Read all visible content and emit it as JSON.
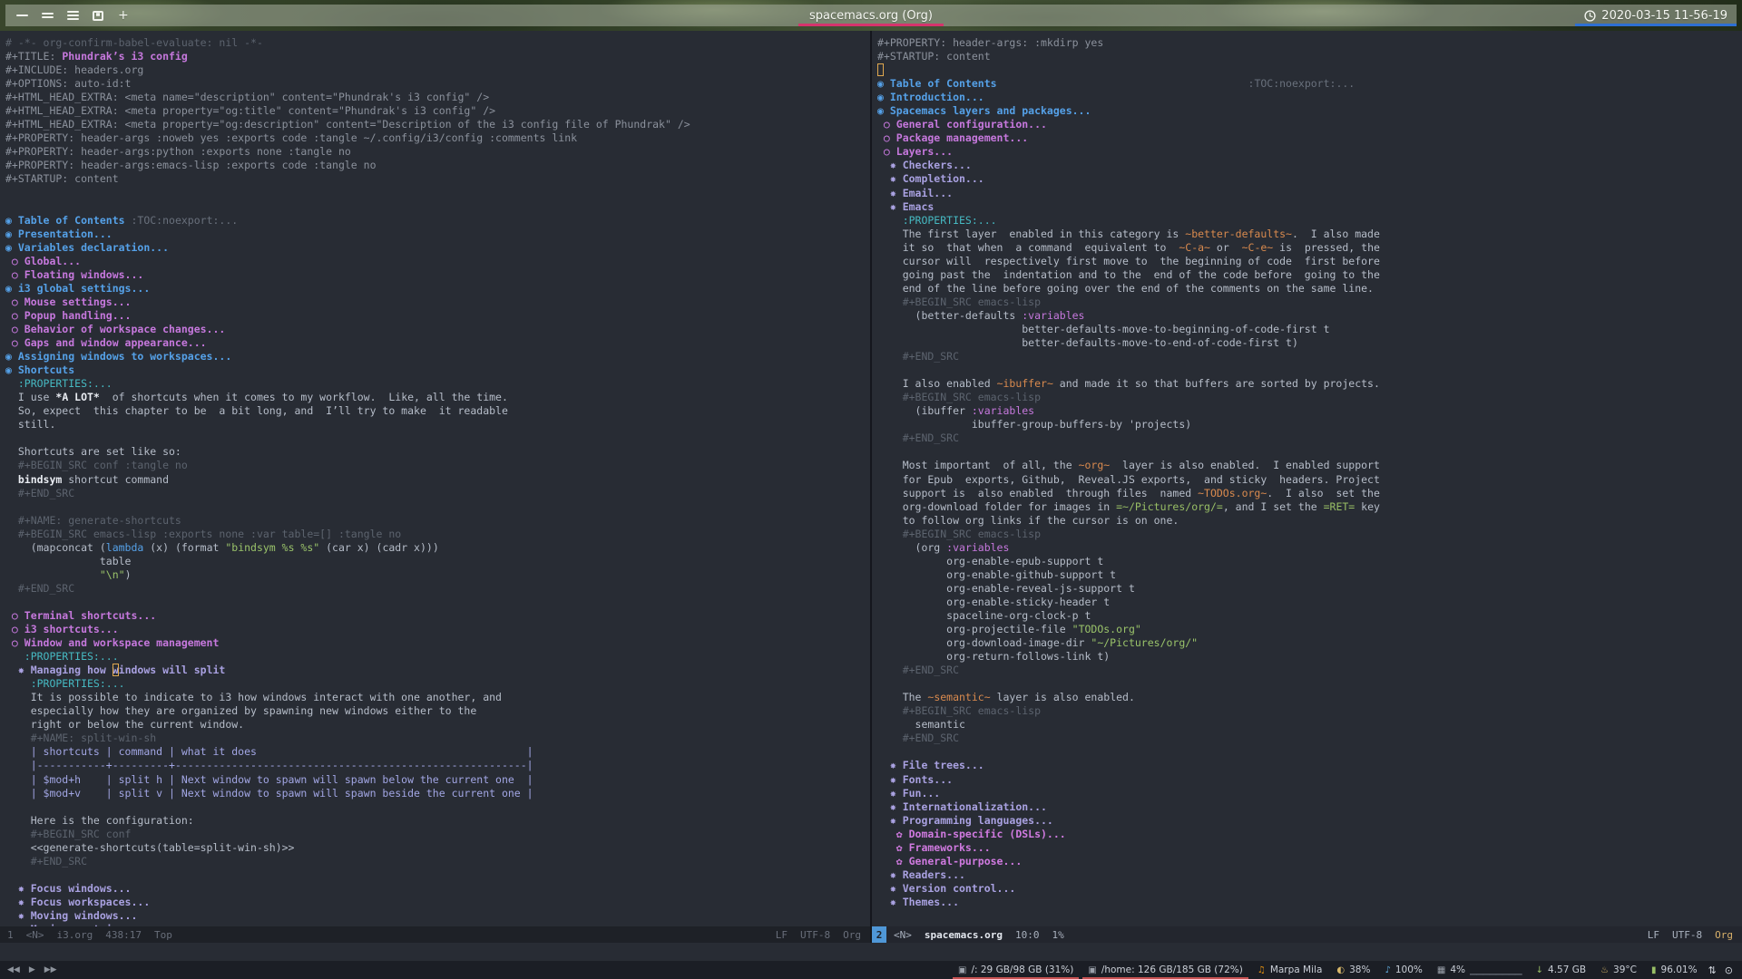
{
  "topbar": {
    "workspaces": [
      {
        "id": "workspace-1",
        "bars": 1
      },
      {
        "id": "workspace-2",
        "bars": 2
      },
      {
        "id": "workspace-3",
        "bars": 3
      },
      {
        "id": "workspace-4",
        "box": true
      },
      {
        "id": "workspace-new",
        "plus": "+"
      }
    ],
    "title": "spacemacs.org (Org)",
    "title_underline": "#d6336c",
    "clock": "2020-03-15 11-56-19",
    "clock_underline": "#2d6fd2"
  },
  "left_window": {
    "modeline": {
      "window_number": "1",
      "evil_state": "<N>",
      "buffer_name": "i3.org",
      "cursor_position": "438:17",
      "scroll_position": "Top",
      "eol": "LF",
      "encoding": "UTF-8",
      "major_mode": "Org"
    },
    "lines": [
      [
        [
          "m",
          "# -*- org-confirm-babel-evaluate: nil -*-"
        ]
      ],
      [
        [
          "k",
          "#+TITLE: "
        ],
        [
          "ti",
          "Phundrak’s i3 config"
        ]
      ],
      [
        [
          "k",
          "#+INCLUDE: headers.org"
        ]
      ],
      [
        [
          "k",
          "#+OPTIONS: auto-id:t"
        ]
      ],
      [
        [
          "k",
          "#+HTML_HEAD_EXTRA: <meta name=\"description\" content=\"Phundrak's i3 config\" />"
        ]
      ],
      [
        [
          "k",
          "#+HTML_HEAD_EXTRA: <meta property=\"og:title\" content=\"Phundrak's i3 config\" />"
        ]
      ],
      [
        [
          "k",
          "#+HTML_HEAD_EXTRA: <meta property=\"og:description\" content=\"Description of the i3 config file of Phundrak\" />"
        ]
      ],
      [
        [
          "k",
          "#+PROPERTY: header-args :noweb yes :exports code :tangle ~/.config/i3/config :comments link"
        ]
      ],
      [
        [
          "k",
          "#+PROPERTY: header-args:python :exports none :tangle no"
        ]
      ],
      [
        [
          "k",
          "#+PROPERTY: header-args:emacs-lisp :exports code :tangle no"
        ]
      ],
      [
        [
          "k",
          "#+STARTUP: content"
        ]
      ],
      [],
      [],
      [
        [
          "h1",
          "◉ Table of Contents "
        ],
        [
          "g",
          ":TOC:noexport:..."
        ]
      ],
      [
        [
          "h1",
          "◉ Presentation..."
        ]
      ],
      [
        [
          "h1",
          "◉ Variables declaration..."
        ]
      ],
      [
        [
          "h2",
          " ○ Global..."
        ]
      ],
      [
        [
          "h2",
          " ○ Floating windows..."
        ]
      ],
      [
        [
          "h1",
          "◉ i3 global settings..."
        ]
      ],
      [
        [
          "h2",
          " ○ Mouse settings..."
        ]
      ],
      [
        [
          "h2",
          " ○ Popup handling..."
        ]
      ],
      [
        [
          "h2",
          " ○ Behavior of workspace changes..."
        ]
      ],
      [
        [
          "h2",
          " ○ Gaps and window appearance..."
        ]
      ],
      [
        [
          "h1",
          "◉ Assigning windows to workspaces..."
        ]
      ],
      [
        [
          "h1",
          "◉ Shortcuts"
        ]
      ],
      [
        [
          "p",
          "  :PROPERTIES:..."
        ]
      ],
      [
        [
          "t",
          "  I use "
        ],
        [
          "B",
          "*A LOT*"
        ],
        [
          "t",
          "  of shortcuts when it comes to my workflow.  Like, all the time."
        ]
      ],
      [
        [
          "t",
          "  So, expect  this chapter to be  a bit long, and  I’ll try to make  it readable"
        ]
      ],
      [
        [
          "t",
          "  still."
        ]
      ],
      [],
      [
        [
          "t",
          "  Shortcuts are set like so:"
        ]
      ],
      [
        [
          "m",
          "  #+BEGIN_SRC conf :tangle no"
        ]
      ],
      [
        [
          "t",
          "  "
        ],
        [
          "B",
          "bindsym"
        ],
        [
          "t",
          " shortcut command"
        ]
      ],
      [
        [
          "m",
          "  #+END_SRC"
        ]
      ],
      [],
      [
        [
          "m",
          "  #+NAME: generate-shortcuts"
        ]
      ],
      [
        [
          "m",
          "  #+BEGIN_SRC emacs-lisp :exports none :var table=[] :tangle no"
        ]
      ],
      [
        [
          "t",
          "    (mapconcat ("
        ],
        [
          "fb",
          "lambda"
        ],
        [
          "t",
          " (x) (format "
        ],
        [
          "s",
          "\"bindsym %s %s\""
        ],
        [
          "t",
          " (car x) (cadr x)))"
        ]
      ],
      [
        [
          "t",
          "               table"
        ]
      ],
      [
        [
          "t",
          "               "
        ],
        [
          "s",
          "\"\\n\""
        ],
        [
          "t",
          ")"
        ]
      ],
      [
        [
          "m",
          "  #+END_SRC"
        ]
      ],
      [],
      [
        [
          "h2",
          " ○ Terminal shortcuts..."
        ]
      ],
      [
        [
          "h2",
          " ○ i3 shortcuts..."
        ]
      ],
      [
        [
          "h2",
          " ○ Window and workspace management"
        ]
      ],
      [
        [
          "p",
          "   :PROPERTIES:..."
        ]
      ],
      [
        [
          "h3",
          "  ✸ Managing how "
        ],
        [
          "h3c",
          "w"
        ],
        [
          "h3",
          "indows will split"
        ]
      ],
      [
        [
          "p",
          "    :PROPERTIES:..."
        ]
      ],
      [
        [
          "t",
          "    It is possible to indicate to i3 how windows interact with one another, and"
        ]
      ],
      [
        [
          "t",
          "    especially how they are organized by spawning new windows either to the"
        ]
      ],
      [
        [
          "t",
          "    right or below the current window."
        ]
      ],
      [
        [
          "m",
          "    #+NAME: split-win-sh"
        ]
      ],
      [
        [
          "tb",
          "    | shortcuts | command | what it does                                           |"
        ]
      ],
      [
        [
          "tb",
          "    |-----------+---------+--------------------------------------------------------|"
        ]
      ],
      [
        [
          "tb",
          "    | $mod+h    | split h | Next window to spawn will spawn below the current one  |"
        ]
      ],
      [
        [
          "tb",
          "    | $mod+v    | split v | Next window to spawn will spawn beside the current one |"
        ]
      ],
      [],
      [
        [
          "t",
          "    Here is the configuration:"
        ]
      ],
      [
        [
          "m",
          "    #+BEGIN_SRC conf"
        ]
      ],
      [
        [
          "t",
          "    <<generate-shortcuts(table=split-win-sh)>>"
        ]
      ],
      [
        [
          "m",
          "    #+END_SRC"
        ]
      ],
      [],
      [
        [
          "h3",
          "  ✸ Focus windows..."
        ]
      ],
      [
        [
          "h3",
          "  ✸ Focus workspaces..."
        ]
      ],
      [
        [
          "h3",
          "  ✸ Moving windows..."
        ]
      ],
      [
        [
          "h3",
          "  ✸ Moving containers..."
        ]
      ]
    ]
  },
  "right_window": {
    "modeline": {
      "window_number": "2",
      "evil_state": "<N>",
      "buffer_name": "spacemacs.org",
      "cursor_position": "10:0",
      "scroll_position": "1%",
      "eol": "LF",
      "encoding": "UTF-8",
      "major_mode": "Org"
    },
    "lines": [
      [
        [
          "k",
          "#+PROPERTY: header-args: :mkdirp yes"
        ]
      ],
      [
        [
          "k",
          "#+STARTUP: content"
        ]
      ],
      [
        [
          "cur",
          " "
        ]
      ],
      [
        [
          "h1",
          "◉ Table of Contents"
        ],
        [
          "t",
          "                                        "
        ],
        [
          "g",
          ":TOC:noexport:..."
        ]
      ],
      [
        [
          "h1",
          "◉ Introduction..."
        ]
      ],
      [
        [
          "h1",
          "◉ Spacemacs layers and packages..."
        ]
      ],
      [
        [
          "h2",
          " ○ General configuration..."
        ]
      ],
      [
        [
          "h2",
          " ○ Package management..."
        ]
      ],
      [
        [
          "h2",
          " ○ Layers..."
        ]
      ],
      [
        [
          "h3",
          "  ✸ Checkers..."
        ]
      ],
      [
        [
          "h3",
          "  ✸ Completion..."
        ]
      ],
      [
        [
          "h3",
          "  ✸ Email..."
        ]
      ],
      [
        [
          "h3",
          "  ✸ Emacs"
        ]
      ],
      [
        [
          "p",
          "    :PROPERTIES:..."
        ]
      ],
      [
        [
          "t",
          "    The first layer  enabled in this category is "
        ],
        [
          "o",
          "~better-defaults~"
        ],
        [
          "t",
          ".  I also made"
        ]
      ],
      [
        [
          "t",
          "    it so  that when  a command  equivalent to  "
        ],
        [
          "o",
          "~C-a~"
        ],
        [
          "t",
          " or  "
        ],
        [
          "o",
          "~C-e~"
        ],
        [
          "t",
          " is  pressed, the"
        ]
      ],
      [
        [
          "t",
          "    cursor will  respectively first move to  the beginning of code  first before"
        ]
      ],
      [
        [
          "t",
          "    going past the  indentation and to the  end of the code before  going to the"
        ]
      ],
      [
        [
          "t",
          "    end of the line before going over the end of the comments on the same line."
        ]
      ],
      [
        [
          "m",
          "    #+BEGIN_SRC emacs-lisp"
        ]
      ],
      [
        [
          "t",
          "      (better-defaults "
        ],
        [
          "fm",
          ":variables"
        ]
      ],
      [
        [
          "t",
          "                       better-defaults-move-to-beginning-of-code-first t"
        ]
      ],
      [
        [
          "t",
          "                       better-defaults-move-to-end-of-code-first t)"
        ]
      ],
      [
        [
          "m",
          "    #+END_SRC"
        ]
      ],
      [],
      [
        [
          "t",
          "    I also enabled "
        ],
        [
          "o",
          "~ibuffer~"
        ],
        [
          "t",
          " and made it so that buffers are sorted by projects."
        ]
      ],
      [
        [
          "m",
          "    #+BEGIN_SRC emacs-lisp"
        ]
      ],
      [
        [
          "t",
          "      (ibuffer "
        ],
        [
          "fm",
          ":variables"
        ]
      ],
      [
        [
          "t",
          "               ibuffer-group-buffers-by 'projects)"
        ]
      ],
      [
        [
          "m",
          "    #+END_SRC"
        ]
      ],
      [],
      [
        [
          "t",
          "    Most important  of all, the "
        ],
        [
          "o",
          "~org~"
        ],
        [
          "t",
          "  layer is also enabled.  I enabled support"
        ]
      ],
      [
        [
          "t",
          "    for Epub  exports, Github,  Reveal.JS exports,  and sticky  headers. Project"
        ]
      ],
      [
        [
          "t",
          "    support is  also enabled  through files  named "
        ],
        [
          "o",
          "~TODOs.org~"
        ],
        [
          "t",
          ".  I also  set the"
        ]
      ],
      [
        [
          "t",
          "    org-download folder for images in "
        ],
        [
          "v",
          "=~/Pictures/org/="
        ],
        [
          "t",
          ", and I set the "
        ],
        [
          "v",
          "=RET="
        ],
        [
          "t",
          " key"
        ]
      ],
      [
        [
          "t",
          "    to follow org links if the cursor is on one."
        ]
      ],
      [
        [
          "m",
          "    #+BEGIN_SRC emacs-lisp"
        ]
      ],
      [
        [
          "t",
          "      (org "
        ],
        [
          "fm",
          ":variables"
        ]
      ],
      [
        [
          "t",
          "           org-enable-epub-support t"
        ]
      ],
      [
        [
          "t",
          "           org-enable-github-support t"
        ]
      ],
      [
        [
          "t",
          "           org-enable-reveal-js-support t"
        ]
      ],
      [
        [
          "t",
          "           org-enable-sticky-header t"
        ]
      ],
      [
        [
          "t",
          "           spaceline-org-clock-p t"
        ]
      ],
      [
        [
          "t",
          "           org-projectile-file "
        ],
        [
          "s",
          "\"TODOs.org\""
        ]
      ],
      [
        [
          "t",
          "           org-download-image-dir "
        ],
        [
          "s",
          "\"~/Pictures/org/\""
        ]
      ],
      [
        [
          "t",
          "           org-return-follows-link t)"
        ]
      ],
      [
        [
          "m",
          "    #+END_SRC"
        ]
      ],
      [],
      [
        [
          "t",
          "    The "
        ],
        [
          "o",
          "~semantic~"
        ],
        [
          "t",
          " layer is also enabled."
        ]
      ],
      [
        [
          "m",
          "    #+BEGIN_SRC emacs-lisp"
        ]
      ],
      [
        [
          "t",
          "      semantic"
        ]
      ],
      [
        [
          "m",
          "    #+END_SRC"
        ]
      ],
      [],
      [
        [
          "h3",
          "  ✸ File trees..."
        ]
      ],
      [
        [
          "h3",
          "  ✸ Fonts..."
        ]
      ],
      [
        [
          "h3",
          "  ✸ Fun..."
        ]
      ],
      [
        [
          "h3",
          "  ✸ Internationalization..."
        ]
      ],
      [
        [
          "h3",
          "  ✸ Programming languages..."
        ]
      ],
      [
        [
          "h4",
          "   ✿ Domain-specific (DSLs)..."
        ]
      ],
      [
        [
          "h4",
          "   ✿ Frameworks..."
        ]
      ],
      [
        [
          "h4",
          "   ✿ General-purpose..."
        ]
      ],
      [
        [
          "h3",
          "  ✸ Readers..."
        ]
      ],
      [
        [
          "h3",
          "  ✸ Version control..."
        ]
      ],
      [
        [
          "h3",
          "  ✸ Themes..."
        ]
      ]
    ]
  },
  "polybar": {
    "media": [
      {
        "id": "media-prev-button",
        "glyph": "◀◀"
      },
      {
        "id": "media-play-button",
        "glyph": "▶"
      },
      {
        "id": "media-next-button",
        "glyph": "▶▶"
      }
    ],
    "modules": [
      {
        "id": "disk-root",
        "icon": "disk-icon",
        "glyph": "▣",
        "color": "#9aa0aa",
        "label": "/: 29 GB/98 GB (31%)",
        "underline": "#c75252"
      },
      {
        "id": "disk-home",
        "icon": "disk-icon",
        "glyph": "▣",
        "color": "#9aa0aa",
        "label": "/home: 126 GB/185 GB (72%)",
        "underline": "#c75252"
      },
      {
        "id": "music",
        "icon": "music-icon",
        "glyph": "♫",
        "color": "#e8920e",
        "label": "Marpa Mila",
        "underline": ""
      },
      {
        "id": "brightness",
        "icon": "brightness-icon",
        "glyph": "◐",
        "color": "#d8b86a",
        "label": "38%",
        "underline": ""
      },
      {
        "id": "volume",
        "icon": "speaker-icon",
        "glyph": "♪",
        "color": "#5fa8d9",
        "label": "100%",
        "underline": ""
      },
      {
        "id": "cpu",
        "icon": "cpu-icon",
        "glyph": "▦",
        "color": "#9aa0aa",
        "label": "4%",
        "spark": "▁▁▁▁▁▁▁▁",
        "underline": ""
      },
      {
        "id": "network-down",
        "icon": "down-arrow-icon",
        "glyph": "↓",
        "color": "#98be65",
        "label": "4.57 GB",
        "underline": ""
      },
      {
        "id": "temperature",
        "icon": "thermometer-icon",
        "glyph": "♨",
        "color": "#d8b86a",
        "label": "39°C",
        "underline": ""
      },
      {
        "id": "battery",
        "icon": "battery-icon",
        "glyph": "▮",
        "color": "#98be65",
        "label": "96.01%",
        "underline": ""
      }
    ],
    "end_icons": [
      {
        "id": "network-icon",
        "glyph": "⇅"
      },
      {
        "id": "power-icon",
        "glyph": "⊙"
      }
    ]
  }
}
